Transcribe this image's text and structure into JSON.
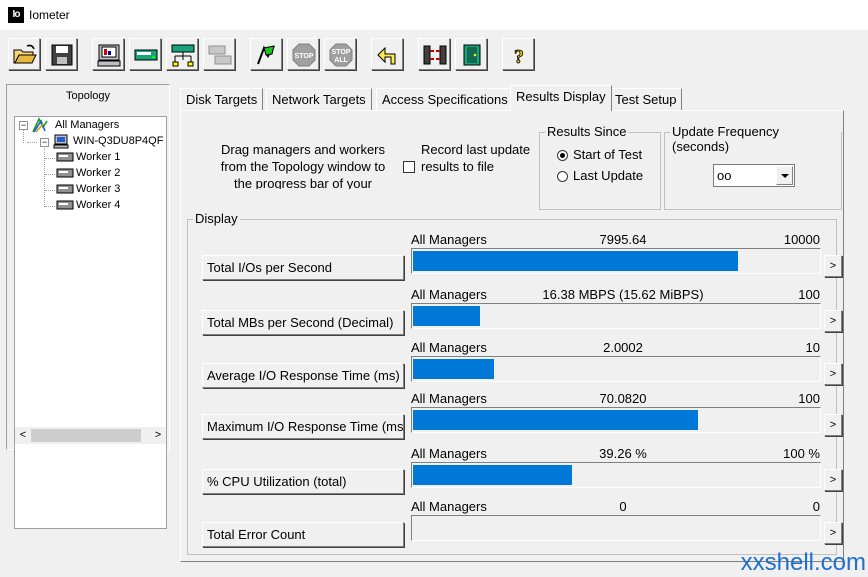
{
  "window": {
    "title": "Iometer",
    "logo": "Io"
  },
  "toolbar": {
    "buttons": [
      {
        "name": "open-config",
        "icon": "folder-open-icon"
      },
      {
        "name": "save-config",
        "icon": "save-icon"
      },
      {
        "name": "start-display",
        "icon": "display-icon"
      },
      {
        "name": "new-worker",
        "icon": "disk-worker-icon"
      },
      {
        "name": "new-network-worker",
        "icon": "network-worker-icon"
      },
      {
        "name": "duplicate-worker",
        "icon": "duplicate-icon"
      },
      {
        "name": "start-tests",
        "icon": "green-flag-icon"
      },
      {
        "name": "stop",
        "icon": "stop-icon"
      },
      {
        "name": "stop-all",
        "icon": "stop-all-icon"
      },
      {
        "name": "reset-workers",
        "icon": "reset-arrow-icon"
      },
      {
        "name": "disconnect",
        "icon": "disconnect-icon"
      },
      {
        "name": "exit",
        "icon": "exit-door-icon"
      },
      {
        "name": "about",
        "icon": "help-icon"
      }
    ]
  },
  "topology": {
    "title": "Topology",
    "root": "All Managers",
    "manager": "WIN-Q3DU8P4QF",
    "workers": [
      "Worker 1",
      "Worker 2",
      "Worker 3",
      "Worker 4"
    ],
    "scroll_left": "<",
    "scroll_right": ">"
  },
  "tabs": [
    {
      "label": "Disk Targets",
      "active": false
    },
    {
      "label": "Network Targets",
      "active": false
    },
    {
      "label": "Access Specifications",
      "active": false
    },
    {
      "label": "Results Display",
      "active": true
    },
    {
      "label": "Test Setup",
      "active": false
    }
  ],
  "results": {
    "drag_text": "Drag managers and workers from the Topology window to the progress bar of your choice.",
    "record_label": "Record last update results to file",
    "results_since": {
      "title": "Results Since",
      "options": [
        "Start of Test",
        "Last Update"
      ],
      "selected": 0
    },
    "update_frequency": {
      "title": "Update Frequency (seconds)",
      "value": "oo"
    },
    "display_title": "Display",
    "colors": {
      "bar": "#0078d7"
    },
    "metrics": [
      {
        "label": "Total I/Os per Second",
        "target": "All Managers",
        "value": "7995.64",
        "max": "10000",
        "fill": 0.7996
      },
      {
        "label": "Total MBs per Second (Decimal)",
        "target": "All Managers",
        "value": "16.38 MBPS (15.62 MiBPS)",
        "max": "100",
        "fill": 0.1638
      },
      {
        "label": "Average I/O Response Time (ms)",
        "target": "All Managers",
        "value": "2.0002",
        "max": "10",
        "fill": 0.2
      },
      {
        "label": "Maximum I/O Response Time (ms)",
        "target": "All Managers",
        "value": "70.0820",
        "max": "100",
        "fill": 0.7008
      },
      {
        "label": "% CPU Utilization (total)",
        "target": "All Managers",
        "value": "39.26 %",
        "max": "100 %",
        "fill": 0.3926
      },
      {
        "label": "Total Error Count",
        "target": "All Managers",
        "value": "0",
        "max": "0",
        "fill": 0
      }
    ],
    "select_button": ">"
  },
  "watermark": "xxshell.com"
}
